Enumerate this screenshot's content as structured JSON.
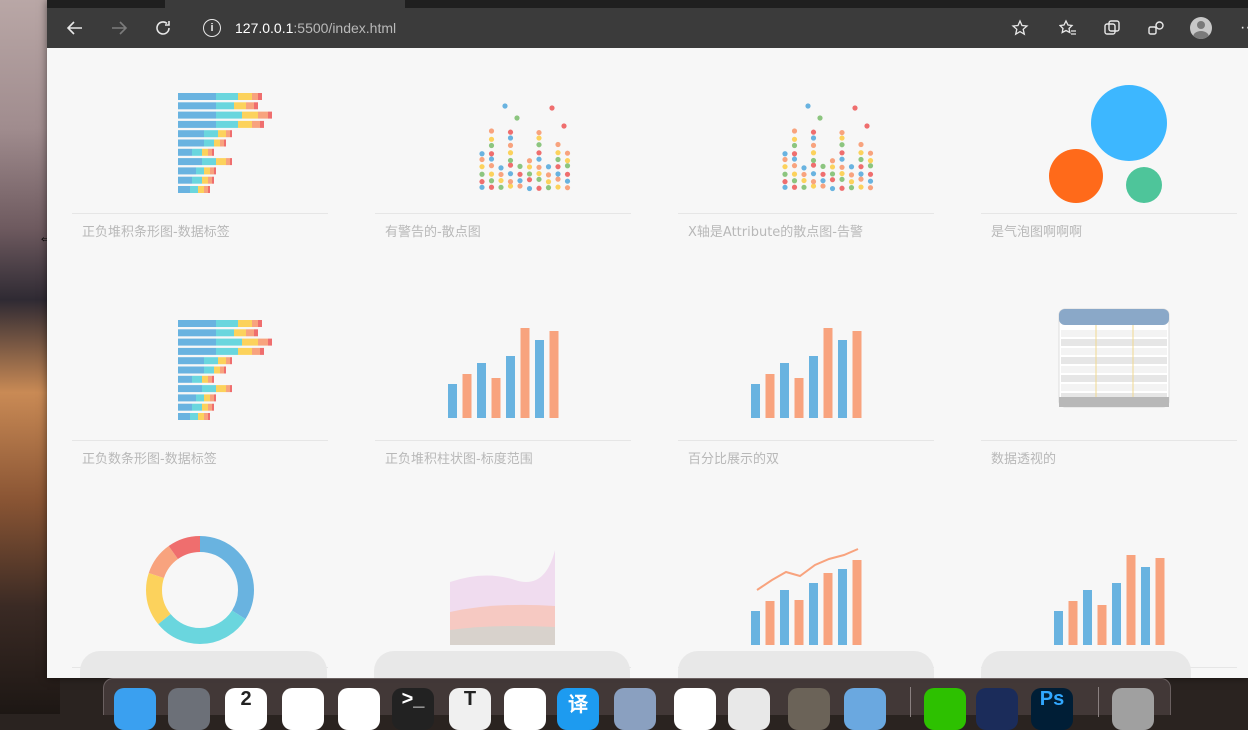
{
  "browser": {
    "url_host": "127.0.0.1",
    "url_path": ":5500/index.html",
    "info_glyph": "i",
    "icons": [
      "back-arrow-icon",
      "forward-arrow-icon",
      "reload-icon",
      "site-info-icon",
      "add-favorite-icon",
      "favorites-icon",
      "collections-icon",
      "extensions-icon",
      "profile-avatar-icon",
      "more-menu-icon"
    ]
  },
  "cards": [
    {
      "label": "正负堆积条形图-数据标签",
      "thumb": "stacked-bar-h"
    },
    {
      "label": "有警告的-散点图",
      "thumb": "scatter"
    },
    {
      "label": "X轴是Attribute的散点图-告警",
      "thumb": "scatter"
    },
    {
      "label": "是气泡图啊啊啊",
      "thumb": "bubble"
    },
    {
      "label": "正负数条形图-数据标签",
      "thumb": "stacked-bar-h"
    },
    {
      "label": "正负堆积柱状图-标度范围",
      "thumb": "column"
    },
    {
      "label": "百分比展示的双",
      "thumb": "column"
    },
    {
      "label": "数据透视的",
      "thumb": "pivot"
    },
    {
      "label": "",
      "thumb": "donut"
    },
    {
      "label": "",
      "thumb": "area"
    },
    {
      "label": "",
      "thumb": "column-line"
    },
    {
      "label": "",
      "thumb": "column"
    }
  ],
  "dock": {
    "items": [
      {
        "name": "finder",
        "color": "#3aa0f0",
        "glyph": ""
      },
      {
        "name": "launchpad",
        "color": "#6c7078",
        "glyph": ""
      },
      {
        "name": "calendar",
        "color": "#ffffff",
        "glyph": "2"
      },
      {
        "name": "chrome",
        "color": "#ffffff",
        "glyph": ""
      },
      {
        "name": "edge",
        "color": "#ffffff",
        "glyph": ""
      },
      {
        "name": "terminal",
        "color": "#222222",
        "glyph": ">_"
      },
      {
        "name": "textedit",
        "color": "#f0f0f0",
        "glyph": "T"
      },
      {
        "name": "baidu-netdisk",
        "color": "#ffffff",
        "glyph": ""
      },
      {
        "name": "translator",
        "color": "#1d9bf0",
        "glyph": "译"
      },
      {
        "name": "preview",
        "color": "#8aa0c0",
        "glyph": ""
      },
      {
        "name": "vscode",
        "color": "#ffffff",
        "glyph": ""
      },
      {
        "name": "screen-recorder",
        "color": "#e8e8e8",
        "glyph": ""
      },
      {
        "name": "calculator",
        "color": "#6b6358",
        "glyph": ""
      },
      {
        "name": "app-store",
        "color": "#6aa8e0",
        "glyph": ""
      },
      {
        "name": "wechat",
        "color": "#2dc100",
        "glyph": ""
      },
      {
        "name": "xmind",
        "color": "#1b2c5a",
        "glyph": ""
      },
      {
        "name": "photoshop",
        "color": "#001e36",
        "glyph": "Ps"
      },
      {
        "name": "trash",
        "color": "#a0a0a0",
        "glyph": ""
      }
    ]
  }
}
